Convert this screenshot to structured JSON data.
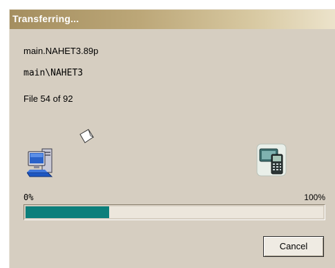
{
  "window": {
    "title": "Transferring..."
  },
  "transfer": {
    "current_file": "main.NAHET3.89p",
    "current_path": "main\\NAHET3",
    "file_counter": "File 54 of 92"
  },
  "icons": {
    "source": "computer-icon",
    "in_transit": "document-icon",
    "destination": "calculator-icon"
  },
  "progress": {
    "min_label": "0%",
    "max_label": "100%",
    "fraction": 0.28,
    "fill_color": "#0c7f7b"
  },
  "buttons": {
    "cancel_label": "Cancel"
  }
}
